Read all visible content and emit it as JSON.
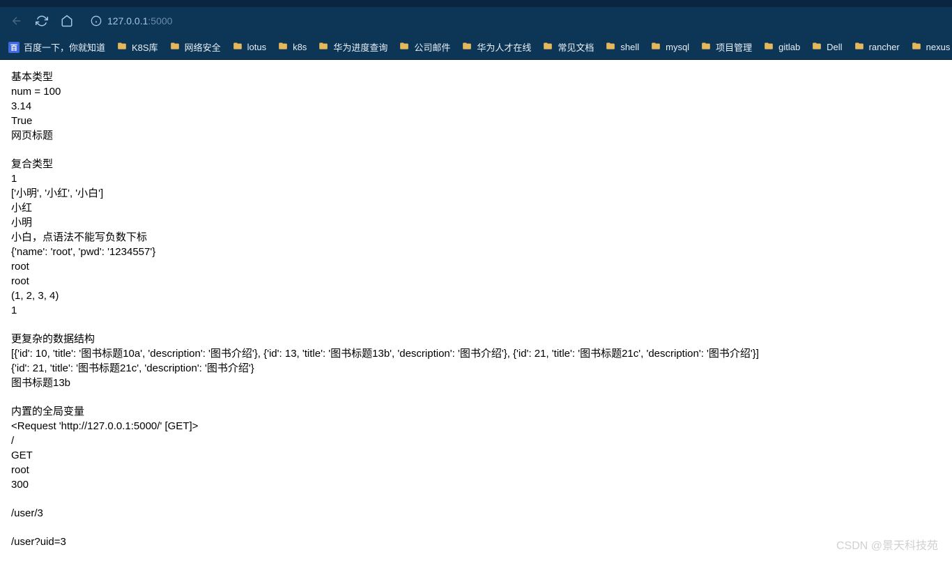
{
  "browser": {
    "url_host": "127.0.0.1",
    "url_port": ":5000"
  },
  "bookmarks": [
    {
      "label": "百度一下，你就知道",
      "type": "baidu"
    },
    {
      "label": "K8S库",
      "type": "folder"
    },
    {
      "label": "网络安全",
      "type": "folder"
    },
    {
      "label": "lotus",
      "type": "folder"
    },
    {
      "label": "k8s",
      "type": "folder"
    },
    {
      "label": "华为进度查询",
      "type": "folder"
    },
    {
      "label": "公司邮件",
      "type": "folder"
    },
    {
      "label": "华为人才在线",
      "type": "folder"
    },
    {
      "label": "常见文档",
      "type": "folder"
    },
    {
      "label": "shell",
      "type": "folder"
    },
    {
      "label": "mysql",
      "type": "folder"
    },
    {
      "label": "项目管理",
      "type": "folder"
    },
    {
      "label": "gitlab",
      "type": "folder"
    },
    {
      "label": "Dell",
      "type": "folder"
    },
    {
      "label": "rancher",
      "type": "folder"
    },
    {
      "label": "nexus",
      "type": "folder"
    }
  ],
  "content": {
    "section1": {
      "title": "基本类型",
      "lines": [
        "num = 100",
        "3.14",
        "True",
        "网页标题"
      ]
    },
    "section2": {
      "title": "复合类型",
      "lines": [
        "1",
        "['小明', '小红', '小白']",
        "小红",
        "小明",
        "小白，点语法不能写负数下标",
        "{'name': 'root', 'pwd': '1234557'}",
        "root",
        "root",
        "(1, 2, 3, 4)",
        "1"
      ]
    },
    "section3": {
      "title": "更复杂的数据结构",
      "lines": [
        "[{'id': 10, 'title': '图书标题10a', 'description': '图书介绍'}, {'id': 13, 'title': '图书标题13b', 'description': '图书介绍'}, {'id': 21, 'title': '图书标题21c', 'description': '图书介绍'}]",
        "{'id': 21, 'title': '图书标题21c', 'description': '图书介绍'}",
        "图书标题13b"
      ]
    },
    "section4": {
      "title": "内置的全局变量",
      "lines": [
        "<Request 'http://127.0.0.1:5000/' [GET]>",
        "/",
        "GET",
        "root",
        "300"
      ]
    },
    "section5": {
      "lines": [
        "/user/3"
      ]
    },
    "section6": {
      "lines": [
        "/user?uid=3"
      ]
    }
  },
  "watermark": "CSDN @景天科技苑"
}
